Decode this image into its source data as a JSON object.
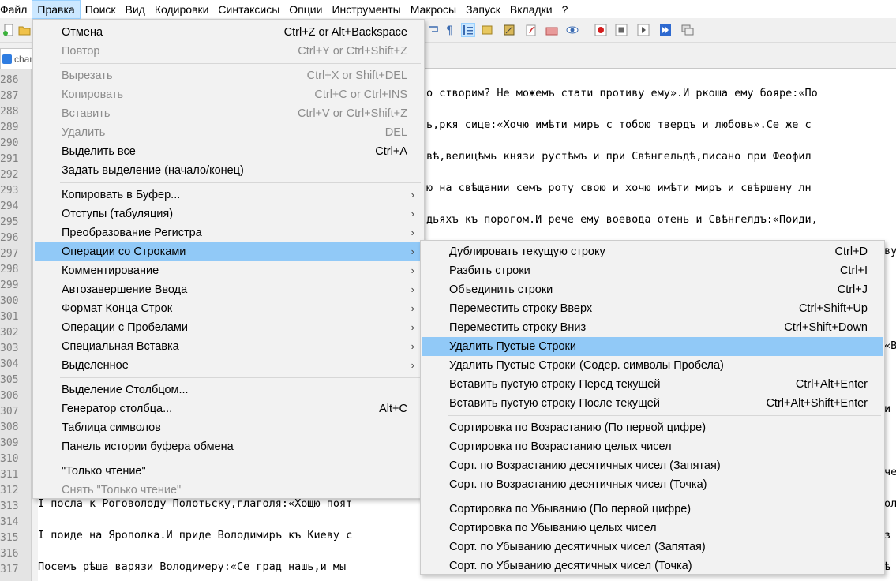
{
  "menubar": {
    "items": [
      "Файл",
      "Правка",
      "Поиск",
      "Вид",
      "Кодировки",
      "Синтаксисы",
      "Опции",
      "Инструменты",
      "Макросы",
      "Запуск",
      "Вкладки",
      "?"
    ]
  },
  "tab": {
    "label": "chan"
  },
  "gutter": {
    "lines": [
      "286",
      "287",
      "288",
      "289",
      "290",
      "291",
      "292",
      "293",
      "294",
      "295",
      "296",
      "297",
      "298",
      "299",
      "300",
      "301",
      "302",
      "303",
      "304",
      "305",
      "306",
      "307",
      "308",
      "309",
      "310",
      "311",
      "312",
      "313",
      "314",
      "315",
      "316",
      "317"
    ]
  },
  "code": {
    "l287": "о створим? Не можемъ стати противу ему».И ркоша ему бояре:«По",
    "l289": "ь,ркя сице:«Хочю имѣти миръ с тобою твердъ и любовь».Се же с",
    "l291": "вѣ,велицѣмь князи рустѣмъ и при Свѣнгельдѣ,писано при Феофил",
    "l293": "ю на свѣщании семъ роту свою и хочю имѣти миръ и свѣршену лн",
    "l295": "дьяхъ къ порогом.И рече ему воевода отень и Свѣнгелдъ:«Поиди,",
    "l297r": "ву",
    "l303r": "«В",
    "l307r": "и",
    "l311r": "че",
    "l313": "I посла к Роговолоду Полотьску,глаголя:«Хощю поят",
    "l313r": "ол",
    "l315": "I поиде на Ярополка.И приде Володимиръ къ Киеву с",
    "l315r": "з",
    "l317": "Посемъ рѣша варязи Володимеру:«Се град нашь,и мы",
    "l317r": "ѣ"
  },
  "edit_menu": {
    "items": [
      {
        "label": "Отмена",
        "shortcut": "Ctrl+Z or Alt+Backspace",
        "disabled": false
      },
      {
        "label": "Повтор",
        "shortcut": "Ctrl+Y or Ctrl+Shift+Z",
        "disabled": true
      },
      {
        "label": "Вырезать",
        "shortcut": "Ctrl+X or Shift+DEL",
        "disabled": true
      },
      {
        "label": "Копировать",
        "shortcut": "Ctrl+C or Ctrl+INS",
        "disabled": true
      },
      {
        "label": "Вставить",
        "shortcut": "Ctrl+V or Ctrl+Shift+Z",
        "disabled": true
      },
      {
        "label": "Удалить",
        "shortcut": "DEL",
        "disabled": true
      },
      {
        "label": "Выделить все",
        "shortcut": "Ctrl+A",
        "disabled": false
      },
      {
        "label": "Задать выделение (начало/конец)",
        "shortcut": "",
        "disabled": false
      },
      {
        "label": "Копировать в Буфер...",
        "submenu": true
      },
      {
        "label": "Отступы (табуляция)",
        "submenu": true
      },
      {
        "label": "Преобразование Регистра",
        "submenu": true
      },
      {
        "label": "Операции со Строками",
        "submenu": true,
        "highlighted": true
      },
      {
        "label": "Комментирование",
        "submenu": true
      },
      {
        "label": "Автозавершение Ввода",
        "submenu": true
      },
      {
        "label": "Формат Конца Строк",
        "submenu": true
      },
      {
        "label": "Операции с Пробелами",
        "submenu": true
      },
      {
        "label": "Специальная Вставка",
        "submenu": true
      },
      {
        "label": "Выделенное",
        "submenu": true
      },
      {
        "label": "Выделение Столбцом...",
        "shortcut": ""
      },
      {
        "label": "Генератор столбца...",
        "shortcut": "Alt+C"
      },
      {
        "label": "Таблица символов",
        "shortcut": ""
      },
      {
        "label": "Панель истории буфера обмена",
        "shortcut": ""
      },
      {
        "label": "\"Только чтение\"",
        "shortcut": ""
      },
      {
        "label": "Снять \"Только чтение\"",
        "shortcut": "",
        "disabled": true
      }
    ],
    "submenu_arrow": "›"
  },
  "line_ops_submenu": {
    "items": [
      {
        "label": "Дублировать текущую строку",
        "shortcut": "Ctrl+D"
      },
      {
        "label": "Разбить строки",
        "shortcut": "Ctrl+I"
      },
      {
        "label": "Объединить строки",
        "shortcut": "Ctrl+J"
      },
      {
        "label": "Переместить строку Вверх",
        "shortcut": "Ctrl+Shift+Up"
      },
      {
        "label": "Переместить строку Вниз",
        "shortcut": "Ctrl+Shift+Down"
      },
      {
        "label": "Удалить Пустые Строки",
        "shortcut": "",
        "highlighted": true
      },
      {
        "label": "Удалить Пустые Строки (Содер. символы Пробела)",
        "shortcut": ""
      },
      {
        "label": "Вставить пустую строку Перед текущей",
        "shortcut": "Ctrl+Alt+Enter"
      },
      {
        "label": "Вставить пустую строку После текущей",
        "shortcut": "Ctrl+Alt+Shift+Enter"
      },
      {
        "label": "Сортировка по Возрастанию (По первой цифре)",
        "shortcut": ""
      },
      {
        "label": "Сортировка по Возрастанию целых чисел",
        "shortcut": ""
      },
      {
        "label": "Сорт. по Возрастанию десятичных чисел (Запятая)",
        "shortcut": ""
      },
      {
        "label": "Сорт. по Возрастанию десятичных чисел (Точка)",
        "shortcut": ""
      },
      {
        "label": "Сортировка по Убыванию (По первой цифре)",
        "shortcut": ""
      },
      {
        "label": "Сортировка по Убыванию целых чисел",
        "shortcut": ""
      },
      {
        "label": "Сорт. по Убыванию десятичных чисел (Запятая)",
        "shortcut": ""
      },
      {
        "label": "Сорт. по Убыванию десятичных чисел (Точка)",
        "shortcut": ""
      }
    ]
  },
  "colors": {
    "highlight": "#91c9f7",
    "menu_bg": "#f2f2f2",
    "active_menu": "#cce8ff",
    "disabled_text": "#8c8c8c"
  }
}
